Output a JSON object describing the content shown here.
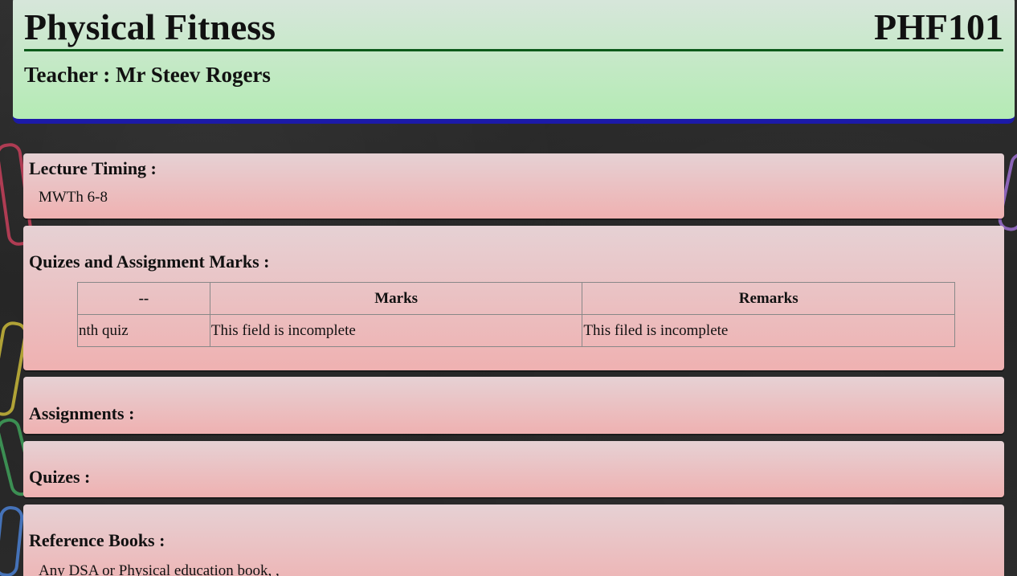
{
  "header": {
    "course_title": "Physical Fitness",
    "course_code": "PHF101",
    "teacher": "Teacher : Mr Steev Rogers"
  },
  "sections": {
    "timing": {
      "heading": "Lecture Timing :",
      "text": "MWTh 6-8"
    },
    "marks": {
      "heading": "Quizes and Assignment Marks :",
      "columns": [
        "--",
        "Marks",
        "Remarks"
      ],
      "rows": [
        [
          "nth quiz",
          "This field is incomplete",
          "This filed is incomplete"
        ]
      ]
    },
    "assignments": {
      "heading": "Assignments :"
    },
    "quizes": {
      "heading": "Quizes :"
    },
    "books": {
      "heading": "Reference Books :",
      "text": "Any DSA or Physical education book, ,"
    }
  },
  "colors": {
    "header_bg_top": "#d8e6dc",
    "header_bg_bottom": "#b4ebb4",
    "header_underline": "#0c5a1a",
    "header_border": "#1c1aa8",
    "section_bg_top": "#e6d1d4",
    "section_bg_bottom": "#efb1b1",
    "page_bg": "#2a2a2a"
  }
}
